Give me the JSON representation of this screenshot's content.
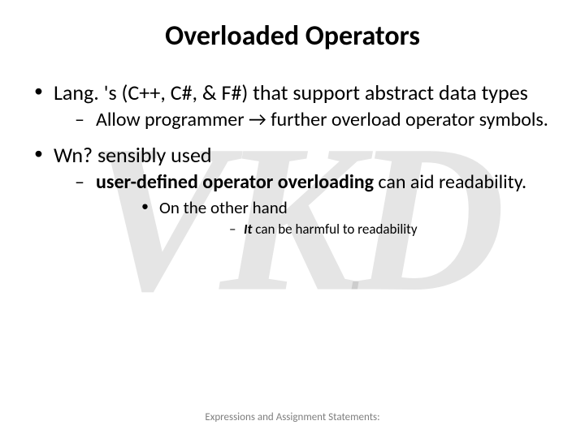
{
  "watermark": "VKD",
  "title": "Overloaded Operators",
  "bullets": {
    "b1": "Lang. 's (C++, C#, & F#) that support abstract data types",
    "b1_1_a": "Allow programmer ",
    "b1_1_arrow": "→",
    "b1_1_b": " further overload operator symbols.",
    "b2": "Wn? sensibly used",
    "b2_1_strong": "user-defined operator overloading",
    "b2_1_rest": " can aid readability.",
    "b2_1_1": "On the other hand",
    "b2_1_1_1_strong": "It",
    "b2_1_1_1_rest": " can be harmful to readability"
  },
  "footer": "Expressions and Assignment Statements:"
}
